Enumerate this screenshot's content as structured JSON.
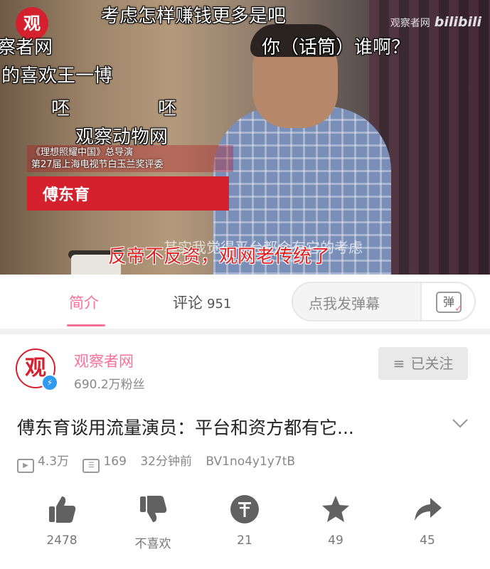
{
  "video": {
    "logo_char": "观",
    "watermark_text": "观察者网",
    "watermark_brand": "bilibili",
    "danmaku": [
      {
        "text": "考虑怎样赚钱更多是吧",
        "color": "white"
      },
      {
        "text": "察者网",
        "color": "white"
      },
      {
        "text": "你（话筒）谁啊？",
        "color": "white"
      },
      {
        "text": "的喜欢王一博",
        "color": "white"
      },
      {
        "text": "呸",
        "color": "white"
      },
      {
        "text": "呸",
        "color": "white"
      },
      {
        "text": "观察动物网",
        "color": "white"
      },
      {
        "text": "反帝不反资，观网老传统了",
        "color": "red"
      }
    ],
    "lower_third": {
      "caption_line1": "《理想照耀中国》总导演",
      "caption_line2": "第27届上海电视节白玉兰奖评委",
      "name": "傅东育"
    },
    "subtitle": "其实我觉得平台都会有它的考虑"
  },
  "tabs": {
    "intro_label": "简介",
    "comments_label": "评论",
    "comments_count": "951",
    "danmu_placeholder": "点我发弹幕",
    "danmu_button_char": "弹"
  },
  "uploader": {
    "avatar_char": "观",
    "name": "观察者网",
    "fans": "690.2万粉丝",
    "follow_label": "已关注"
  },
  "video_info": {
    "title": "傅东育谈用流量演员：平台和资方都有它...",
    "views": "4.3万",
    "danmaku_count": "169",
    "time_ago": "32分钟前",
    "bvid": "BV1no4y1y7tB"
  },
  "actions": [
    {
      "icon": "thumbs-up-icon",
      "label": "2478"
    },
    {
      "icon": "thumbs-down-icon",
      "label": "不喜欢"
    },
    {
      "icon": "coin-icon",
      "label": "21"
    },
    {
      "icon": "star-icon",
      "label": "49"
    },
    {
      "icon": "share-icon",
      "label": "45"
    }
  ],
  "colors": {
    "accent_pink": "#fb7299",
    "brand_red": "#d5202d",
    "text_gray": "#888888"
  }
}
